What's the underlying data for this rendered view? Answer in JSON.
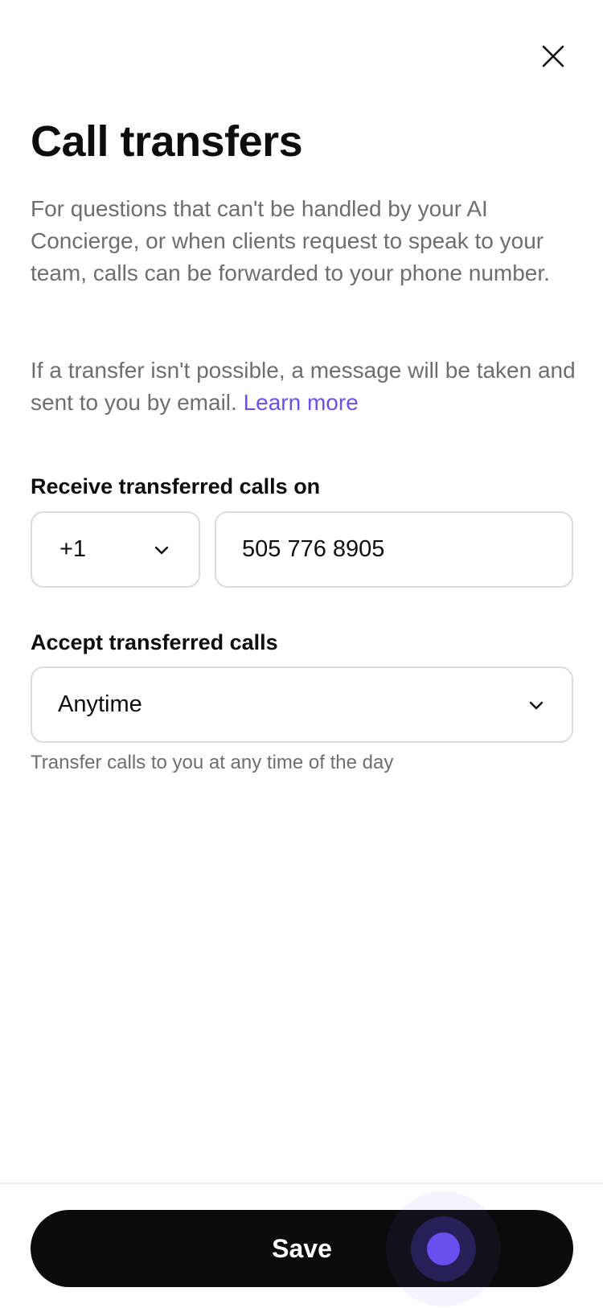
{
  "header": {
    "title": "Call transfers",
    "close_icon": "close-icon"
  },
  "description": {
    "paragraph_1": "For questions that can't be handled by your AI Concierge, or when clients request to speak to your team, calls can be forwarded to your phone number.",
    "paragraph_2_text": "If a transfer isn't possible, a message will be taken and sent to you by email. ",
    "learn_more_link": "Learn more"
  },
  "receive_section": {
    "label": "Receive transferred calls on",
    "country_code": "+1",
    "phone_number": "505 776 8905"
  },
  "accept_section": {
    "label": "Accept transferred calls",
    "selected_option": "Anytime",
    "helper_text": "Transfer calls to you at any time of the day"
  },
  "footer": {
    "save_label": "Save"
  },
  "colors": {
    "accent": "#6c4fe8",
    "primary_button": "#0b0b0b",
    "text_primary": "#0d0d0d",
    "text_secondary": "#6e6e6e",
    "border": "#dcdcdc"
  }
}
